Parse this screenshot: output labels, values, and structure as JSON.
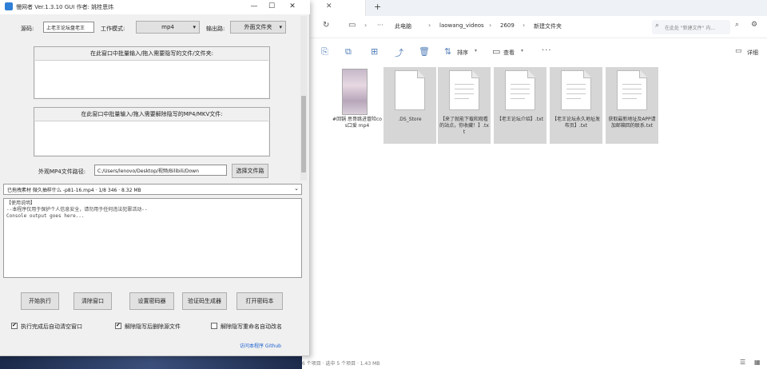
{
  "app": {
    "title": "慢网者 Ver.1.3.10 GUI 作者: 姚桂恩炜",
    "win_minimize": "—",
    "win_maximize": "☐",
    "win_close": "✕",
    "row1": {
      "source_label": "源码:",
      "source_value": "上老王论坛盘老王",
      "mode_label": "工作模式:",
      "mode_value": "mp4",
      "output_label": "输出路:",
      "output_button": "外面文件夹"
    },
    "drop_area_1": {
      "title": "在此窗口中批量输入/拖入需要隐写的文件/文件夹:"
    },
    "drop_area_2": {
      "title": "在此窗口中批量输入/拖入需要解除隐写的MP4/MKV文件:"
    },
    "cover_mp4": {
      "label": "外观MP4文件路径:",
      "path_value": "C:/Users/lenovo/Desktop/视频/Bilibili/Down",
      "choose_button": "选择文件路"
    },
    "selected_file": "已拖拽素材 微久抽样什么 -p81-16.mp4 · 1/8 346 · 8.32 MB",
    "console_lines": [
      "【使用说明】",
      "--本程序仅用于保护个人信息安全，请勿用于任何违法犯罪活动--",
      "Console output goes here..."
    ],
    "buttons": {
      "start": "开始执行",
      "clear": "清除窗口",
      "password": "设置密码器",
      "verify": "验证码生成器",
      "open_page": "打开密码本"
    },
    "checkboxes": [
      {
        "label": "执行完成后自动清空窗口",
        "checked": true
      },
      {
        "label": "解除隐写后删除源文件",
        "checked": true
      },
      {
        "label": "解除隐写重命名自动改名",
        "checked": false
      }
    ],
    "footer_link": "访问本程序 Github"
  },
  "explorer": {
    "tab_close": "✕",
    "new_tab": "+",
    "nav": {
      "refresh": "↻",
      "screen": "▭",
      "more": "···"
    },
    "breadcrumbs": [
      "此电脑",
      "laowang_videos",
      "2609",
      "新建文件夹"
    ],
    "search_placeholder": "在此处 \"新建文件\" 内...",
    "toolbar": {
      "sort_label": "排序",
      "view_label": "查看",
      "more": "···",
      "details_label": "详细"
    },
    "files": [
      {
        "name": "#回锅 思哥跳进冒险cos口爱 mp4",
        "kind": "video",
        "selected": false
      },
      {
        "name": ".DS_Store",
        "kind": "blank",
        "selected": true
      },
      {
        "name": "【来了就能下载和观看的站点，你收藏！】.txt",
        "kind": "text",
        "selected": true
      },
      {
        "name": "【老王论坛介绍】.txt",
        "kind": "text",
        "selected": true
      },
      {
        "name": "【老王论坛永久地址发布页】.txt",
        "kind": "text",
        "selected": true
      },
      {
        "name": "获取最新地址及APP请加邮箱回的联系.txt",
        "kind": "text",
        "selected": true
      }
    ],
    "status_text": "6 个项目 · 选中 5 个项目 · 1.43 MB"
  }
}
